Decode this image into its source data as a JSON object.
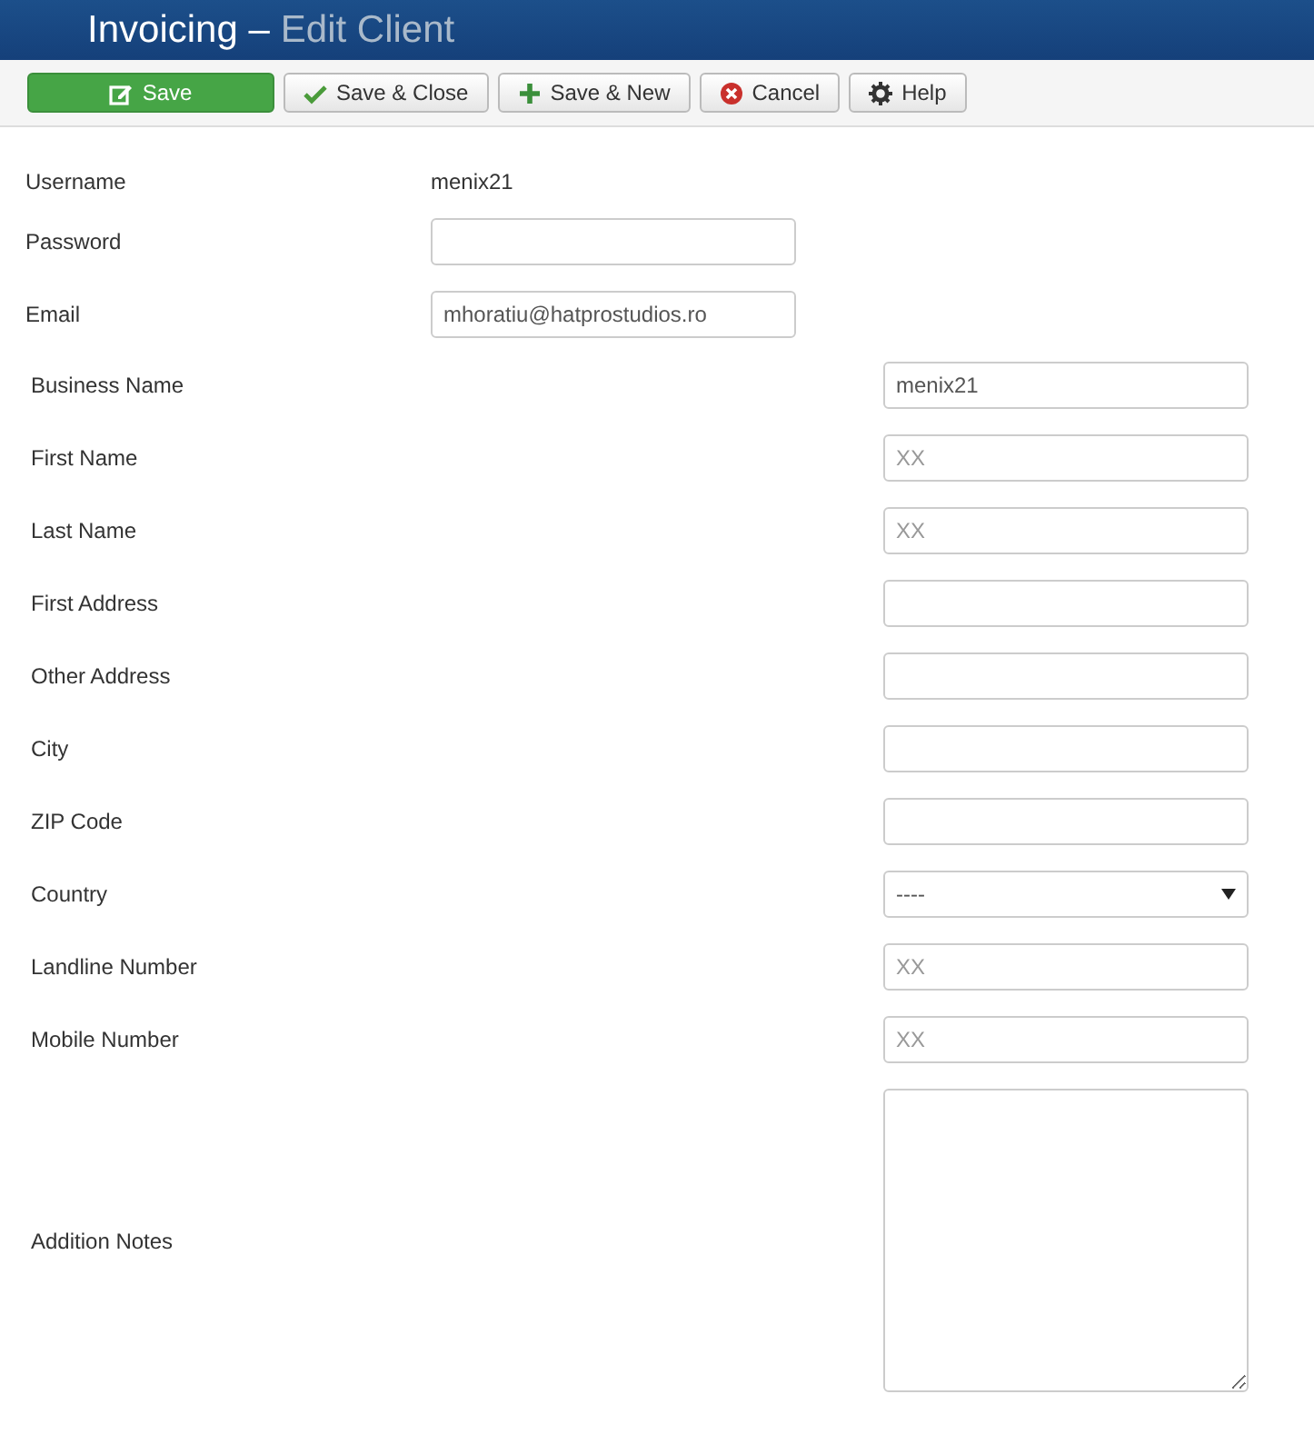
{
  "header": {
    "title": "Invoicing",
    "separator": "–",
    "subtitle": "Edit Client"
  },
  "toolbar": [
    {
      "label": "Save",
      "kind": "edit",
      "primary": true
    },
    {
      "label": "Save & Close",
      "kind": "check",
      "primary": false
    },
    {
      "label": "Save & New",
      "kind": "plus",
      "primary": false
    },
    {
      "label": "Cancel",
      "kind": "cancel",
      "primary": false
    },
    {
      "label": "Help",
      "kind": "gear",
      "primary": false
    }
  ],
  "account": [
    {
      "label": "Username",
      "kind": "static",
      "value": "menix21"
    },
    {
      "label": "Password",
      "kind": "text"
    },
    {
      "label": "Email",
      "kind": "text",
      "value": "mhoratiu@hatprostudios.ro"
    }
  ],
  "details": [
    {
      "label": "Business Name",
      "kind": "text",
      "value": "menix21"
    },
    {
      "label": "First Name",
      "kind": "text",
      "placeholder": "XX"
    },
    {
      "label": "Last Name",
      "kind": "text",
      "placeholder": "XX"
    },
    {
      "label": "First Address",
      "kind": "text"
    },
    {
      "label": "Other Address",
      "kind": "text"
    },
    {
      "label": "City",
      "kind": "text"
    },
    {
      "label": "ZIP Code",
      "kind": "text"
    },
    {
      "label": "Country",
      "kind": "select",
      "value": "----"
    },
    {
      "label": "Landline Number",
      "kind": "text",
      "placeholder": "XX"
    },
    {
      "label": "Mobile Number",
      "kind": "text",
      "placeholder": "XX"
    },
    {
      "label": "Addition Notes",
      "kind": "textarea"
    }
  ]
}
